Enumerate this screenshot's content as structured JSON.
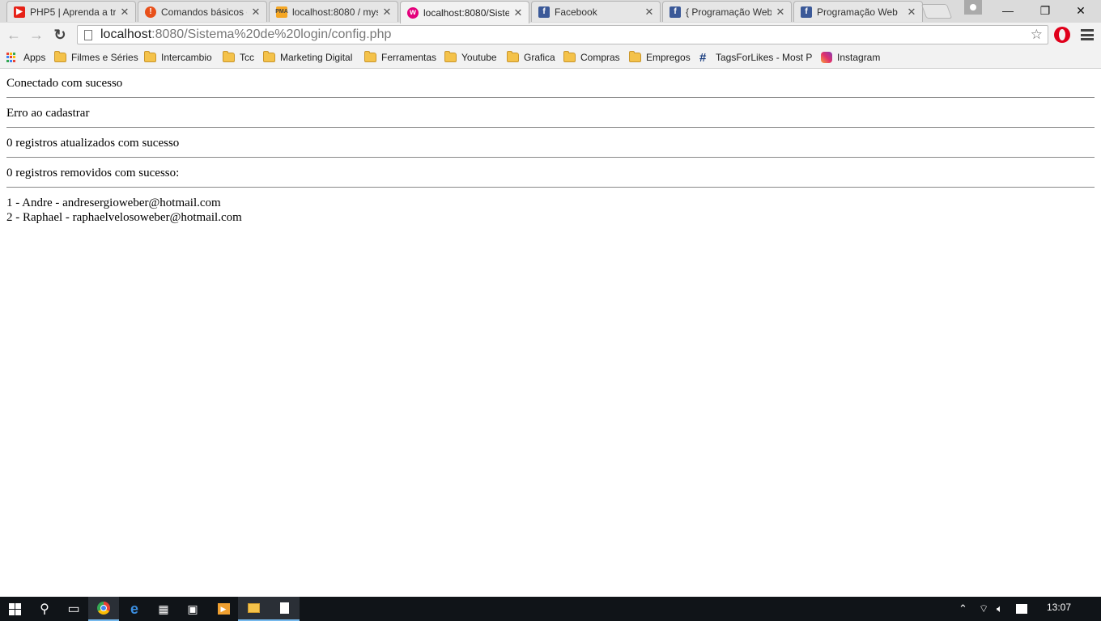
{
  "browser": {
    "tabs": [
      {
        "title": "PHP5 | Aprenda a tr",
        "favicon": "youtube-icon",
        "color": "#e62117"
      },
      {
        "title": "Comandos básicos d",
        "favicon": "alert-icon",
        "color": "#e8501a"
      },
      {
        "title": "localhost:8080 / mys",
        "favicon": "phpmyadmin-icon",
        "color": "#f5a623"
      },
      {
        "title": "localhost:8080/Siste",
        "favicon": "wamp-icon",
        "color": "#e4007c",
        "active": true
      },
      {
        "title": "Facebook",
        "favicon": "facebook-icon",
        "color": "#3b5998"
      },
      {
        "title": "{ Programação Web",
        "favicon": "facebook-icon",
        "color": "#3b5998"
      },
      {
        "title": "Programação Web",
        "favicon": "facebook-icon",
        "color": "#3b5998"
      }
    ],
    "window_controls": {
      "minimize": "—",
      "restore": "❐",
      "close": "✕"
    },
    "address_bar": {
      "host": "localhost",
      "rest": ":8080/Sistema%20de%20login/config.php"
    },
    "bookmarks": [
      {
        "label": "Apps",
        "icon": "apps-grid-icon"
      },
      {
        "label": "Filmes e Séries",
        "icon": "folder-icon"
      },
      {
        "label": "Intercambio",
        "icon": "folder-icon"
      },
      {
        "label": "Tcc",
        "icon": "folder-icon"
      },
      {
        "label": "Marketing Digital",
        "icon": "folder-icon"
      },
      {
        "label": "Ferramentas",
        "icon": "folder-icon"
      },
      {
        "label": "Youtube",
        "icon": "folder-icon"
      },
      {
        "label": "Grafica",
        "icon": "folder-icon"
      },
      {
        "label": "Compras",
        "icon": "folder-icon"
      },
      {
        "label": "Empregos",
        "icon": "folder-icon"
      },
      {
        "label": "TagsForLikes - Most P",
        "icon": "hashtag-icon"
      },
      {
        "label": "Instagram",
        "icon": "instagram-icon"
      }
    ]
  },
  "page": {
    "messages": [
      "Conectado com sucesso",
      "Erro ao cadastrar",
      "0 registros atualizados com sucesso",
      "0 registros removidos com sucesso:"
    ],
    "records": [
      "1 - Andre - andresergioweber@hotmail.com",
      "2 - Raphael - raphaelvelosoweber@hotmail.com"
    ]
  },
  "taskbar": {
    "clock": "13:07",
    "accent": "#76b9ed"
  }
}
